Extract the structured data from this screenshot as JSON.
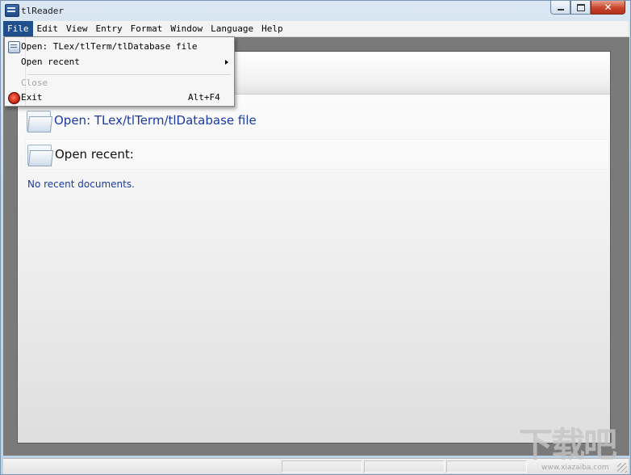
{
  "window": {
    "title": "tlReader",
    "caption_close": "✕"
  },
  "menubar": {
    "items": [
      {
        "label": "File",
        "active": true
      },
      {
        "label": "Edit"
      },
      {
        "label": "View"
      },
      {
        "label": "Entry"
      },
      {
        "label": "Format"
      },
      {
        "label": "Window"
      },
      {
        "label": "Language"
      },
      {
        "label": "Help"
      }
    ]
  },
  "file_menu": {
    "open_label": "Open: TLex/tlTerm/tlDatabase file",
    "open_recent_label": "Open recent",
    "close_label": "Close",
    "exit_label": "Exit",
    "exit_shortcut": "Alt+F4"
  },
  "start_page": {
    "open_link": "Open: TLex/tlTerm/tlDatabase file",
    "open_recent_heading": "Open recent:",
    "no_recent_text": "No recent documents."
  },
  "watermark": {
    "glyphs": "下载吧",
    "url": "www.xiazaiba.com"
  },
  "colors": {
    "menu_highlight": "#1f4f8c",
    "link": "#1a3aa0",
    "close_button": "#c9432b"
  },
  "icons": {
    "app": "app-icon",
    "open": "open-file-icon",
    "exit": "exit-icon",
    "folder": "folder-icon"
  }
}
